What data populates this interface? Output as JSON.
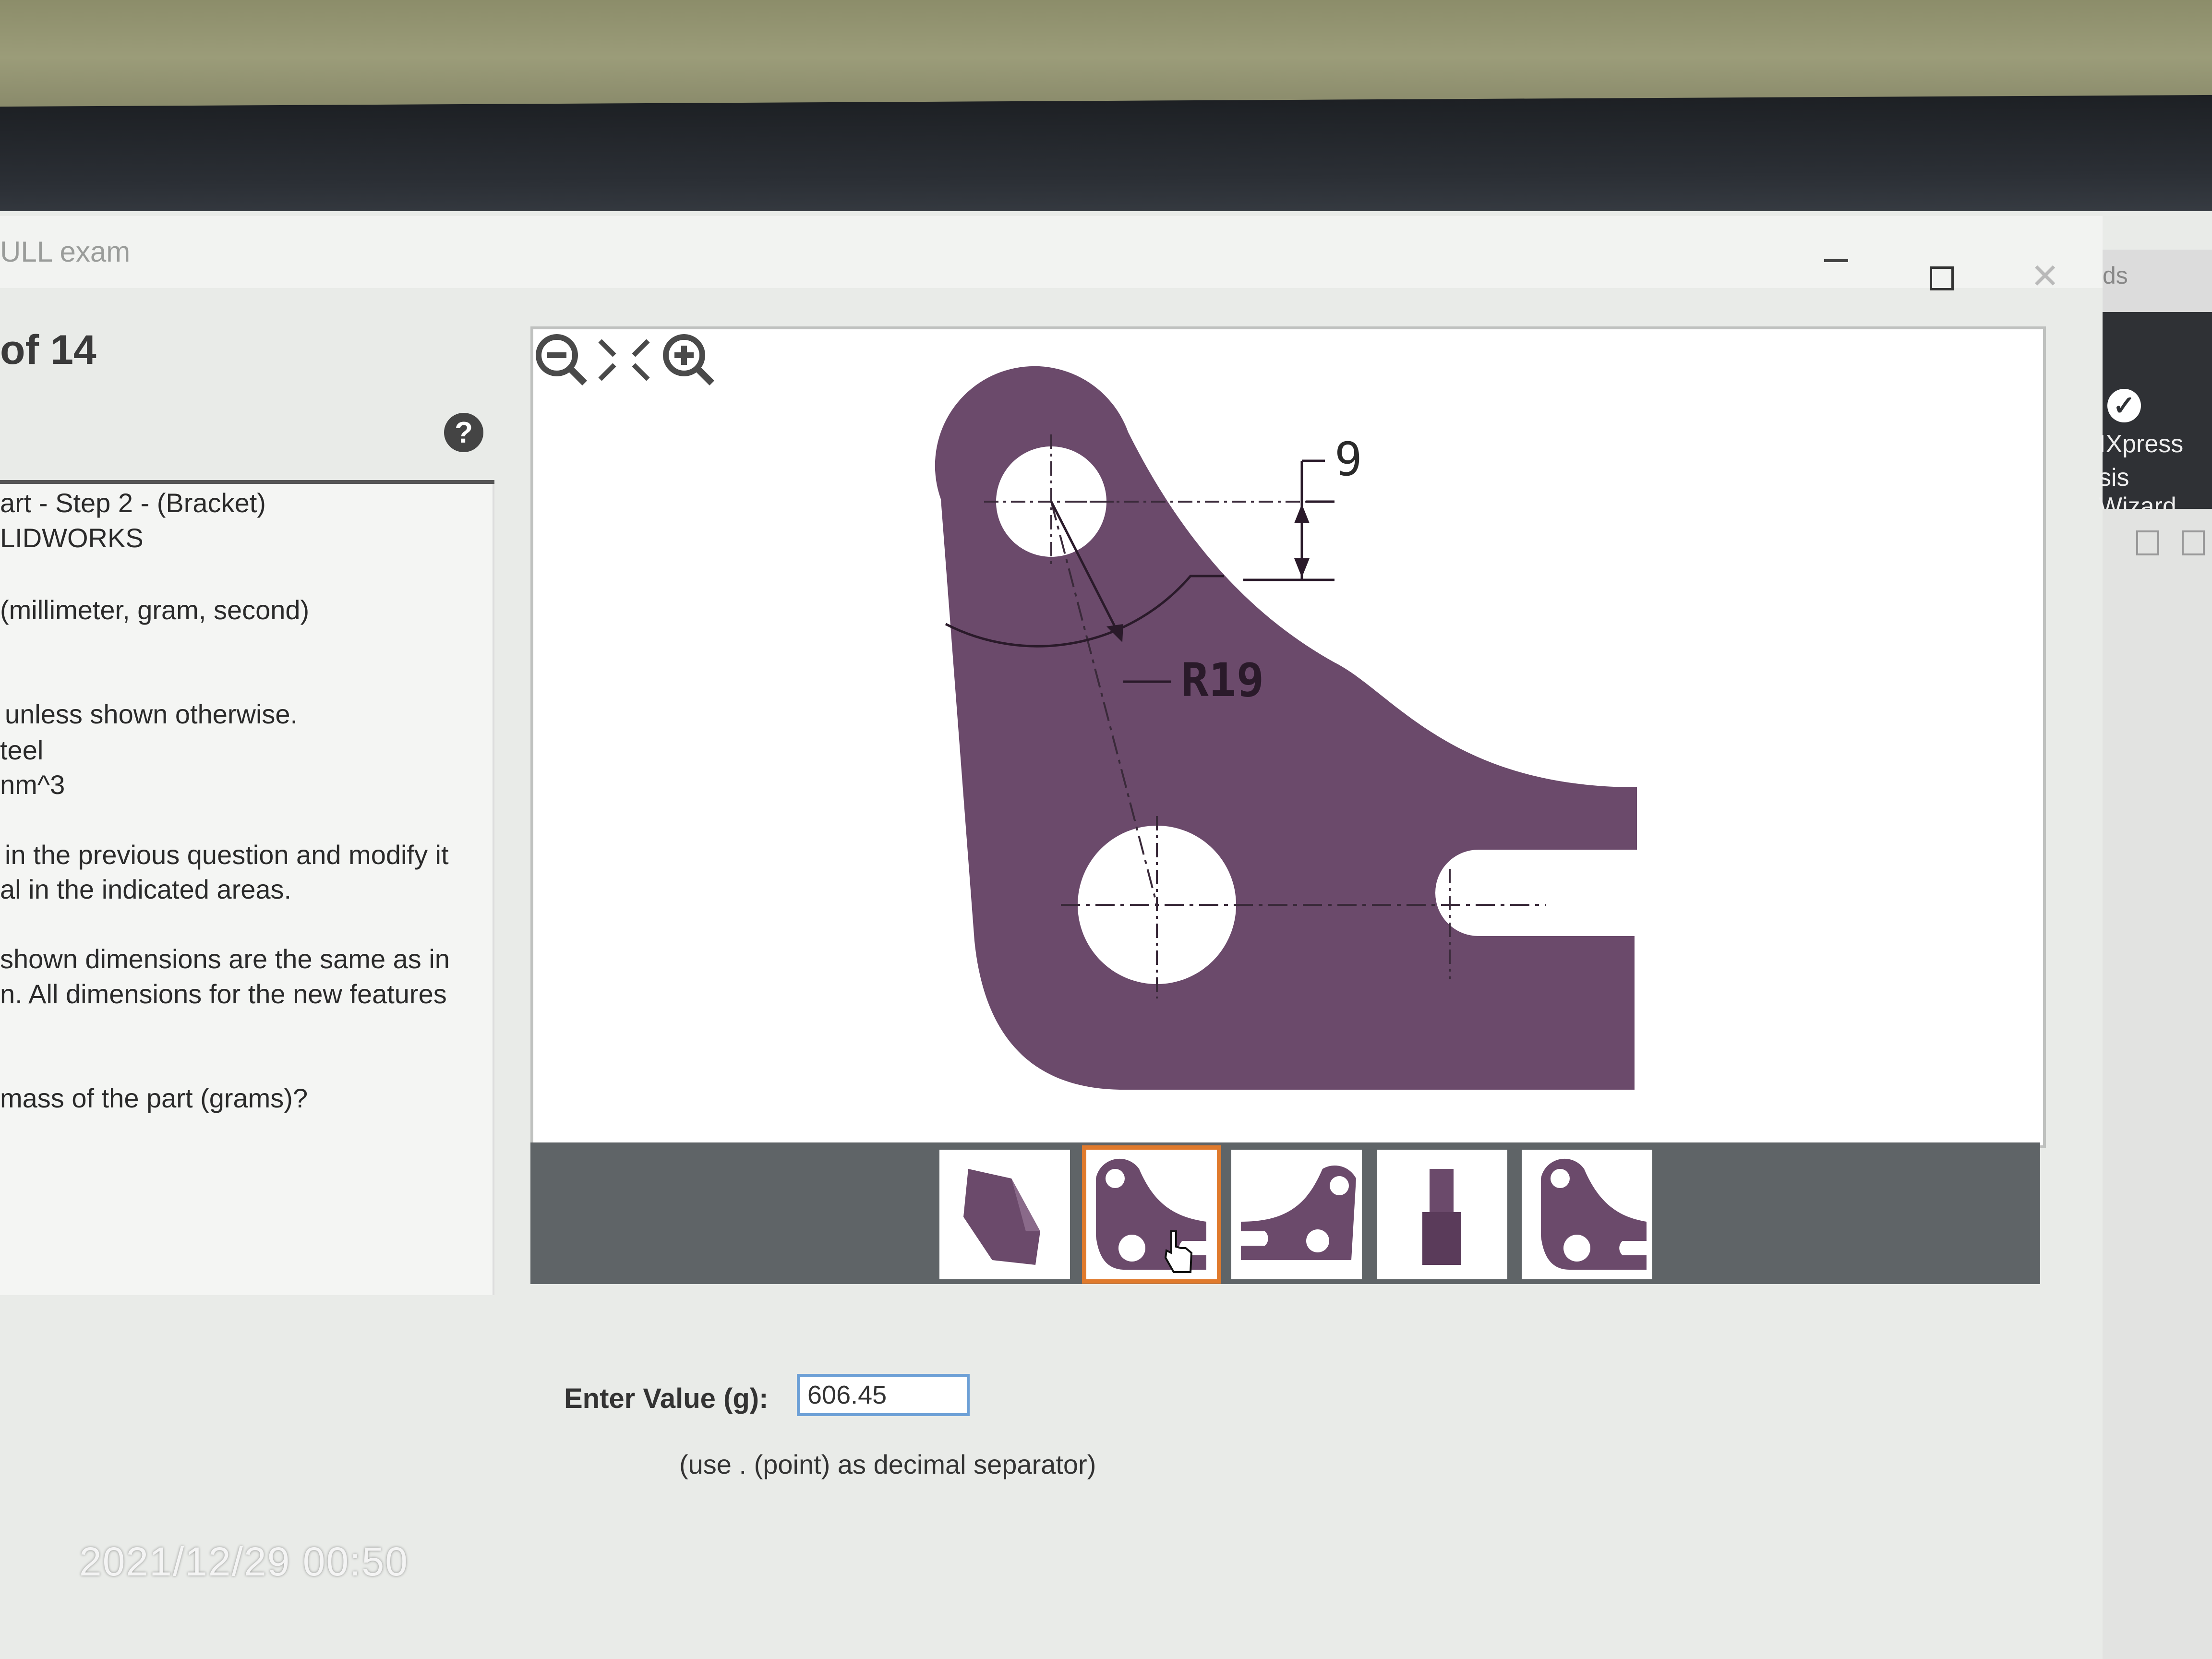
{
  "window": {
    "title": "ULL exam"
  },
  "question": {
    "counter": "of 14",
    "lines": [
      "art - Step 2 - (Bracket)",
      "LIDWORKS",
      "(millimeter, gram, second)",
      "unless shown otherwise.",
      "teel",
      "nm^3",
      "in the previous question and modify it",
      "al in the indicated areas.",
      "shown dimensions are the same as in",
      "n.  All dimensions for the new features",
      "mass of the part (grams)?"
    ]
  },
  "drawing": {
    "dim_top": "9",
    "dim_radius": "R19",
    "part_color": "#6b4a6b"
  },
  "thumbnails": [
    "thumb-iso-view",
    "thumb-front-view",
    "thumb-side-view",
    "thumb-top-view",
    "thumb-back-view"
  ],
  "answer": {
    "label": "Enter Value (g):",
    "value": "606.45",
    "note": "(use . (point) as decimal separator)"
  },
  "right_panel": {
    "top_label": "ds",
    "line1": "IXpress",
    "line2": "sis Wizard"
  },
  "timestamp": "2021/12/29 00:50",
  "colors": {
    "accent": "#e07a2c",
    "input_border": "#6da0d6"
  }
}
